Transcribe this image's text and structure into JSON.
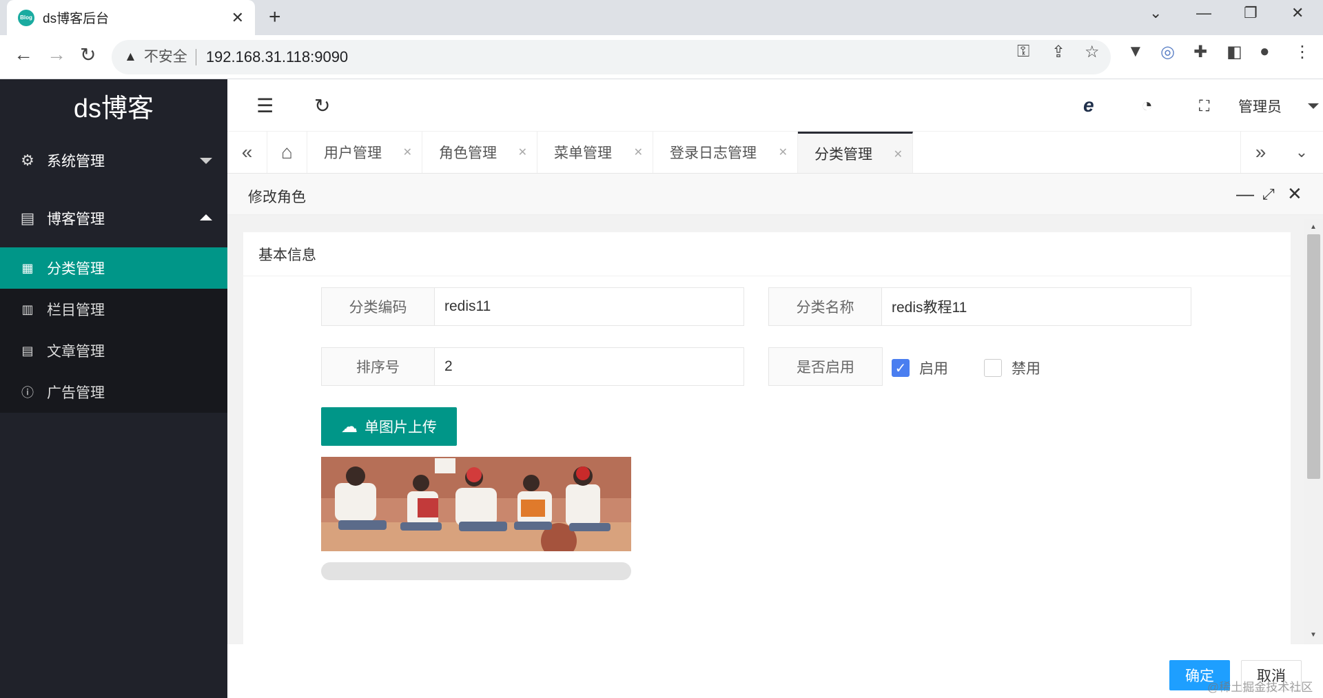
{
  "browser": {
    "tab_title": "ds博客后台",
    "favicon_text": "Blog",
    "security_label": "不安全",
    "url": "192.168.31.118:9090"
  },
  "sidebar": {
    "brand": "ds博客",
    "groups": [
      {
        "label": "系统管理",
        "icon": "gear-icon",
        "expanded": false
      },
      {
        "label": "博客管理",
        "icon": "calendar-icon",
        "expanded": true
      }
    ],
    "items": [
      {
        "label": "分类管理",
        "icon": "grid-icon",
        "active": true
      },
      {
        "label": "栏目管理",
        "icon": "columns-icon",
        "active": false
      },
      {
        "label": "文章管理",
        "icon": "document-icon",
        "active": false
      },
      {
        "label": "广告管理",
        "icon": "info-icon",
        "active": false
      }
    ]
  },
  "header": {
    "user_label": "管理员"
  },
  "page_tabs": [
    {
      "label": "用户管理",
      "active": false
    },
    {
      "label": "角色管理",
      "active": false
    },
    {
      "label": "菜单管理",
      "active": false
    },
    {
      "label": "登录日志管理",
      "active": false
    },
    {
      "label": "分类管理",
      "active": true
    }
  ],
  "dialog": {
    "title": "修改角色",
    "section_title": "基本信息",
    "fields": {
      "code": {
        "label": "分类编码",
        "value": "redis11"
      },
      "name": {
        "label": "分类名称",
        "value": "redis教程11"
      },
      "sort": {
        "label": "排序号",
        "value": "2"
      },
      "enabled": {
        "label": "是否启用",
        "options": [
          "启用",
          "禁用"
        ],
        "selected": "启用"
      }
    },
    "upload_label": "单图片上传",
    "upload_progress": 0,
    "ok_label": "确定",
    "cancel_label": "取消"
  },
  "watermark": "@稀土掘金技术社区",
  "colors": {
    "sidebar_bg": "#20222a",
    "accent": "#009688",
    "primary_button": "#1e9fff",
    "checkbox": "#4a7ef0"
  }
}
